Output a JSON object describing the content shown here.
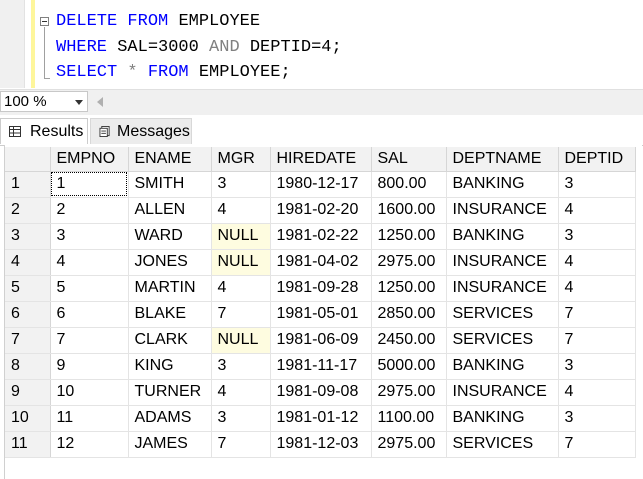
{
  "editor": {
    "line1": {
      "k1": "DELETE",
      "k2": "FROM",
      "t1": "EMPLOYEE"
    },
    "line2": {
      "k1": "WHERE",
      "t1": "SAL=3000",
      "op": "AND",
      "t2": "DEPTID=4;"
    },
    "line3": {
      "k1": "SELECT",
      "op": "*",
      "k2": "FROM",
      "t1": "EMPLOYEE;"
    }
  },
  "zoom": {
    "value": "100 %"
  },
  "tabs": {
    "results": "Results",
    "messages": "Messages"
  },
  "grid": {
    "columns": [
      "EMPNO",
      "ENAME",
      "MGR",
      "HIREDATE",
      "SAL",
      "DEPTNAME",
      "DEPTID"
    ],
    "rows": [
      [
        "1",
        "1",
        "SMITH",
        "3",
        "1980-12-17",
        "800.00",
        "BANKING",
        "3"
      ],
      [
        "2",
        "2",
        "ALLEN",
        "4",
        "1981-02-20",
        "1600.00",
        "INSURANCE",
        "4"
      ],
      [
        "3",
        "3",
        "WARD",
        "NULL",
        "1981-02-22",
        "1250.00",
        "BANKING",
        "3"
      ],
      [
        "4",
        "4",
        "JONES",
        "NULL",
        "1981-04-02",
        "2975.00",
        "INSURANCE",
        "4"
      ],
      [
        "5",
        "5",
        "MARTIN",
        "4",
        "1981-09-28",
        "1250.00",
        "INSURANCE",
        "4"
      ],
      [
        "6",
        "6",
        "BLAKE",
        "7",
        "1981-05-01",
        "2850.00",
        "SERVICES",
        "7"
      ],
      [
        "7",
        "7",
        "CLARK",
        "NULL",
        "1981-06-09",
        "2450.00",
        "SERVICES",
        "7"
      ],
      [
        "8",
        "9",
        "KING",
        "3",
        "1981-11-17",
        "5000.00",
        "BANKING",
        "3"
      ],
      [
        "9",
        "10",
        "TURNER",
        "4",
        "1981-09-08",
        "2975.00",
        "INSURANCE",
        "4"
      ],
      [
        "10",
        "11",
        "ADAMS",
        "3",
        "1981-01-12",
        "1100.00",
        "BANKING",
        "3"
      ],
      [
        "11",
        "12",
        "JAMES",
        "7",
        "1981-12-03",
        "2975.00",
        "SERVICES",
        "7"
      ]
    ]
  }
}
